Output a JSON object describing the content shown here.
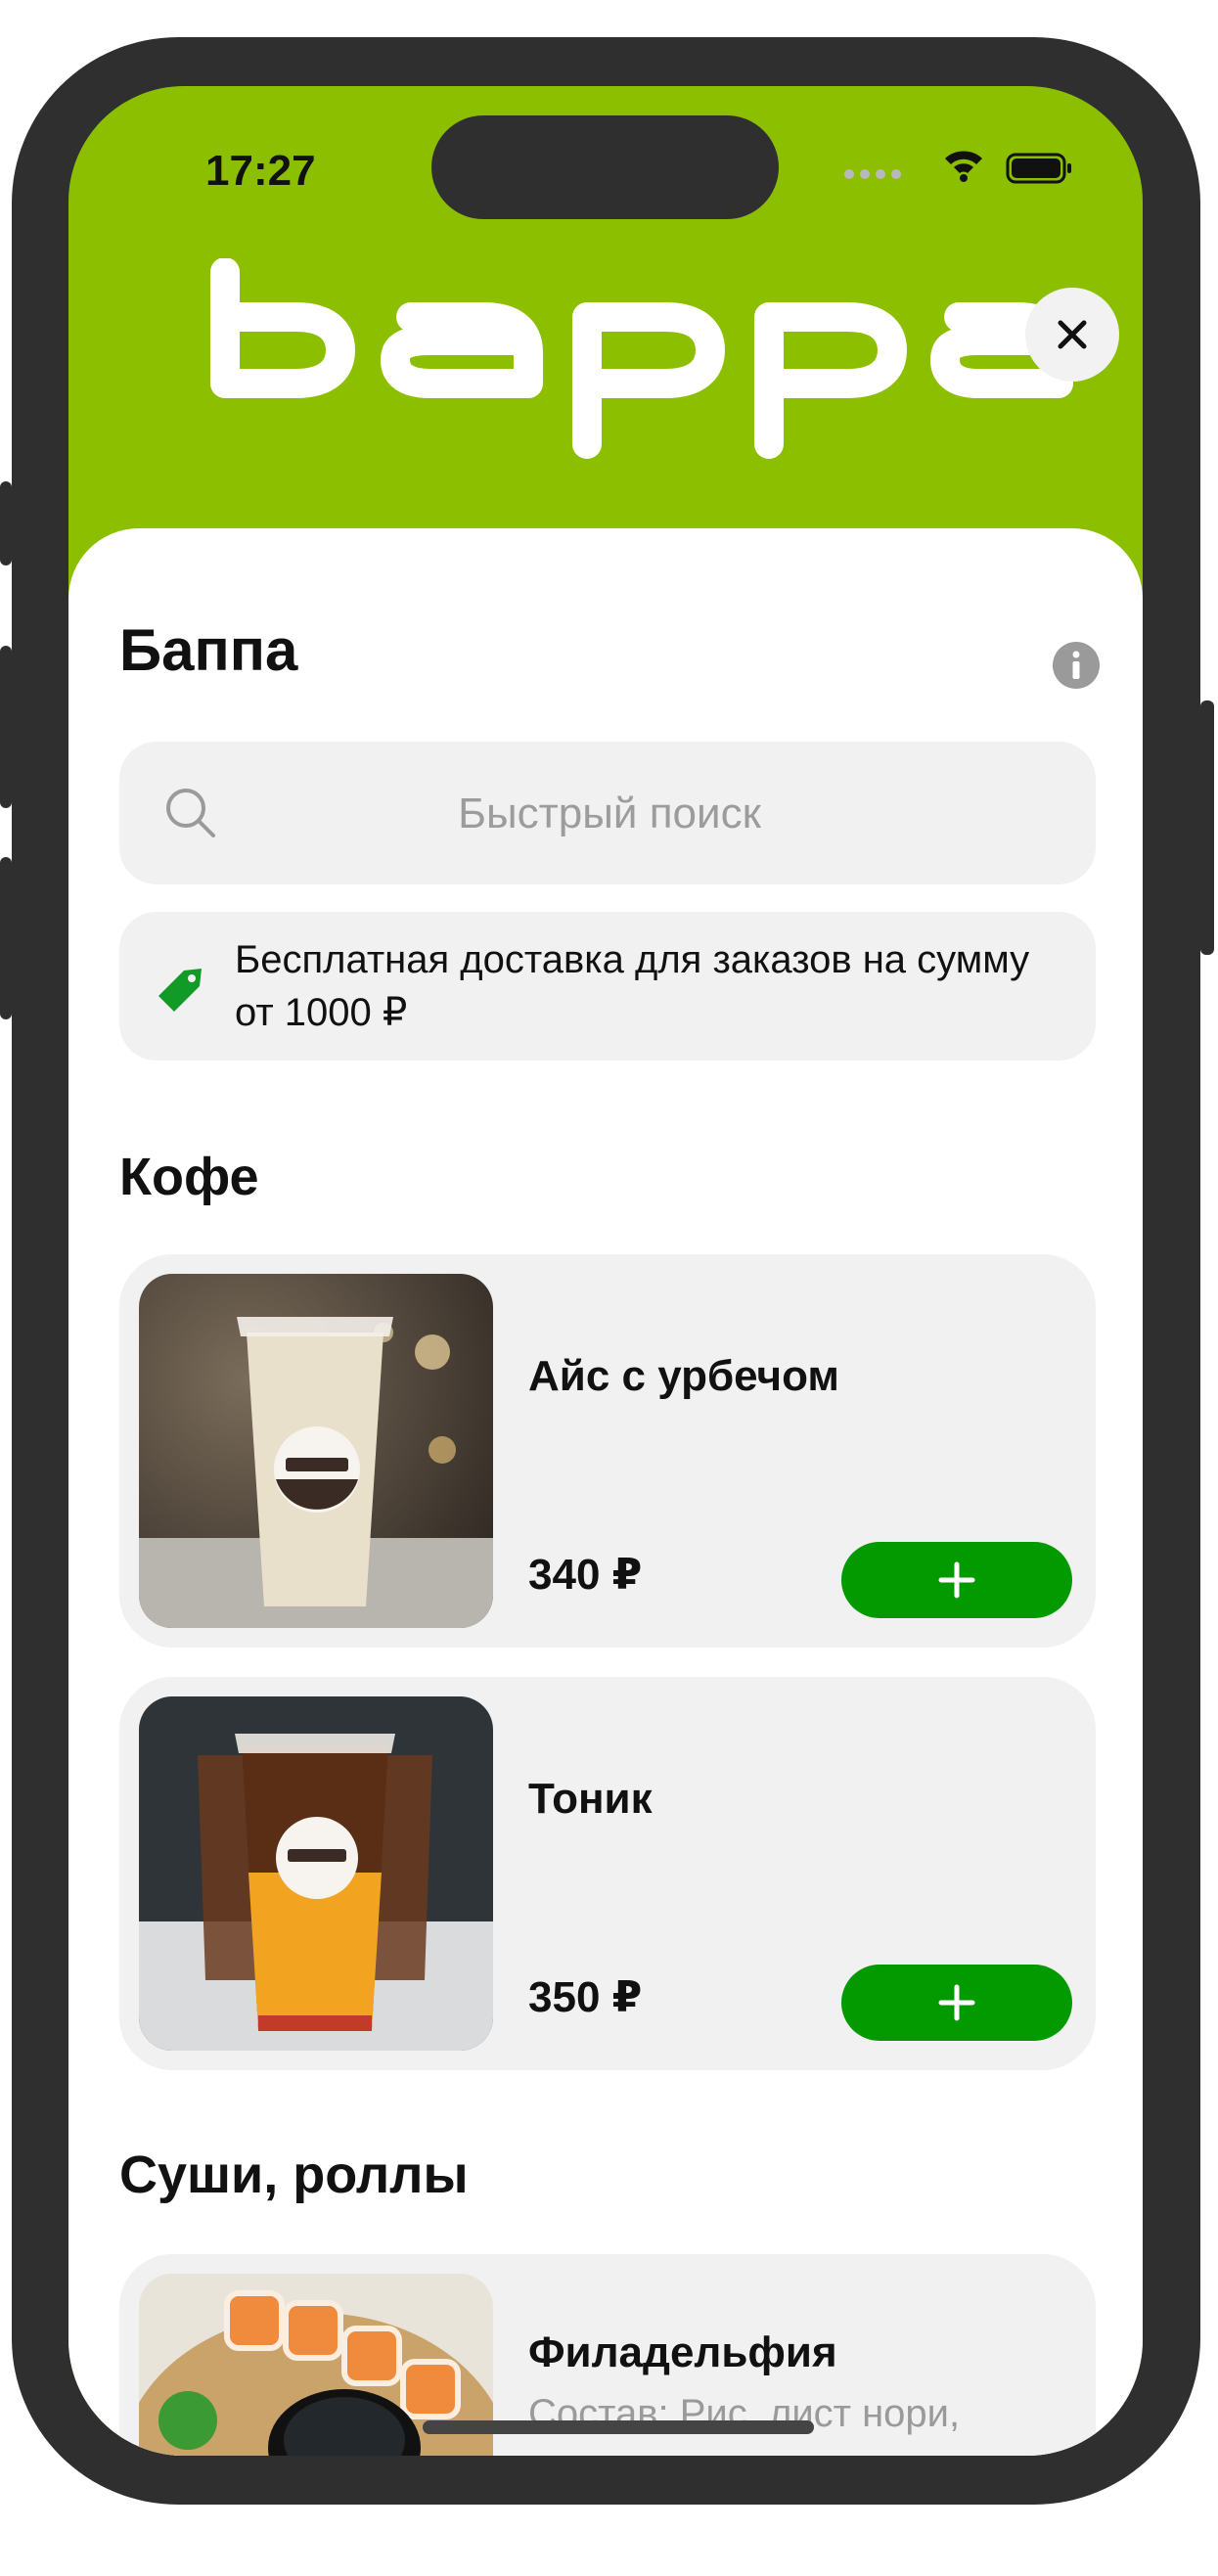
{
  "status_bar": {
    "time": "17:27"
  },
  "brand": {
    "logo_text": "bappa",
    "accent_color": "#8cbf00",
    "button_color": "#039a00"
  },
  "header": {
    "title": "Баппа"
  },
  "search": {
    "placeholder": "Быстрый поиск",
    "value": ""
  },
  "promo": {
    "text": "Бесплатная доставка для заказов на сумму от 1000 ₽"
  },
  "sections": [
    {
      "title": "Кофе",
      "items": [
        {
          "name": "Айс с урбечом",
          "price": "340 ₽"
        },
        {
          "name": "Тоник",
          "price": "350 ₽"
        }
      ]
    },
    {
      "title": "Суши, роллы",
      "items": [
        {
          "name": "Филадельфия",
          "description": "Состав: Рис, лист нори, лосось, огурец, творож…"
        }
      ]
    }
  ],
  "icons": {
    "close": "close-icon",
    "info": "info-icon",
    "search": "search-icon",
    "promo": "tag-icon",
    "add": "plus-icon"
  }
}
